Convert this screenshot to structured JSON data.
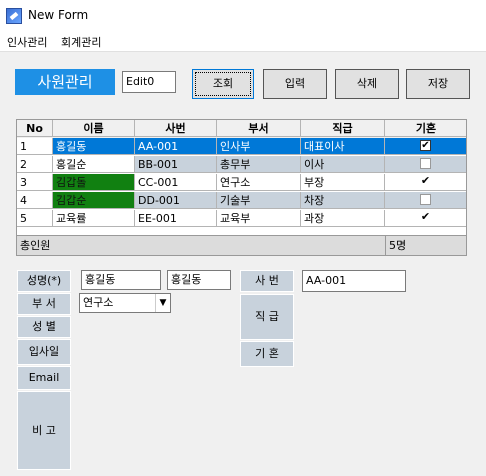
{
  "window": {
    "title": "New Form"
  },
  "menu": [
    "인사관리",
    "회계관리"
  ],
  "toolbar": {
    "heading": "사원관리",
    "edit_value": "Edit0",
    "search_label": "조회",
    "input_label": "입력",
    "delete_label": "삭제",
    "save_label": "저장"
  },
  "grid": {
    "headers": [
      "No",
      "이름",
      "사번",
      "부서",
      "직급",
      "기혼"
    ],
    "rows": [
      {
        "no": "1",
        "name": "홍길동",
        "id": "AA-001",
        "dept": "인사부",
        "rank": "대표이사",
        "married": true
      },
      {
        "no": "2",
        "name": "홍길순",
        "id": "BB-001",
        "dept": "총무부",
        "rank": "이사",
        "married": false
      },
      {
        "no": "3",
        "name": "김갑돌",
        "id": "CC-001",
        "dept": "연구소",
        "rank": "부장",
        "married": true
      },
      {
        "no": "4",
        "name": "김갑순",
        "id": "DD-001",
        "dept": "기술부",
        "rank": "차장",
        "married": false
      },
      {
        "no": "5",
        "name": "교육률",
        "id": "EE-001",
        "dept": "교육부",
        "rank": "과장",
        "married": true
      }
    ],
    "footer_label": "총인원",
    "footer_count": "5명"
  },
  "form": {
    "name_label": "성명(*)",
    "name_value": "홍길동",
    "name_value2": "홍길동",
    "dept_label": "부 서",
    "dept_value": "연구소",
    "gender_label": "성 별",
    "hire_label": "입사일",
    "email_label": "Email",
    "note_label": "비 고",
    "empno_label": "사 번",
    "empno_value": "AA-001",
    "rank_label": "직 급",
    "married_label": "기 혼"
  },
  "colors": {
    "accent": "#1e90e5",
    "selected": "#0078d7",
    "highlight": "#118011",
    "alt_row": "#c8d2dc"
  }
}
